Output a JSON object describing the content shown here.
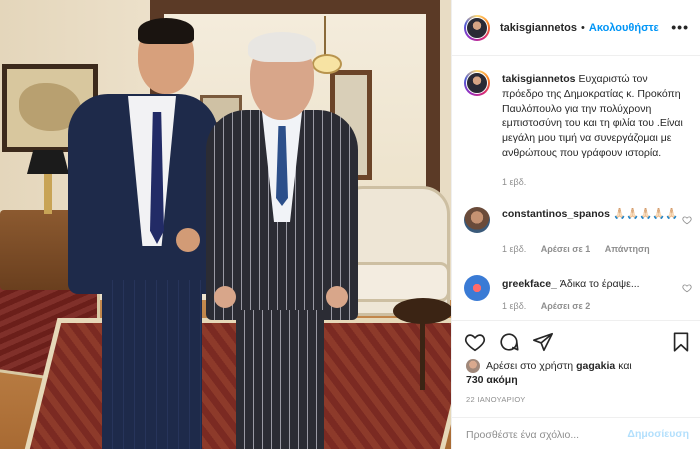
{
  "header": {
    "username": "takisgiannetos",
    "separator": "•",
    "follow_label": "Ακολουθήστε",
    "more_label": "•••"
  },
  "caption": {
    "username": "takisgiannetos",
    "text": "Ευχαριστώ τον πρόεδρο της Δημοκρατίας κ. Προκόπη Παυλόπουλο για την πολύχρονη εμπιστοσύνη του και τη φιλία του .Είναι μεγάλη μου τιμή να συνεργάζομαι με ανθρώπους που γράφουν ιστορία.",
    "age": "1 εβδ."
  },
  "comments": [
    {
      "username": "constantinos_spanos",
      "text": "🙏🏻🙏🏻🙏🏻🙏🏻🙏🏻",
      "age": "1 εβδ.",
      "likes": "Αρέσει σε 1",
      "reply": "Απάντηση"
    },
    {
      "username": "greekface_",
      "text": "Άδικα το έραψε...",
      "age": "1 εβδ.",
      "likes": "Αρέσει σε 2",
      "reply": ""
    }
  ],
  "actions": {
    "like_icon": "heart-icon",
    "comment_icon": "comment-icon",
    "share_icon": "paper-plane-icon",
    "save_icon": "bookmark-icon"
  },
  "likes": {
    "prefix": "Αρέσει στο χρήστη",
    "user": "gagakia",
    "conjunction": "και",
    "others": "730 ακόμη"
  },
  "date": "22 ΙΑΝΟΥΑΡΙΟΥ",
  "add_comment": {
    "placeholder": "Προσθέστε ένα σχόλιο...",
    "post_label": "Δημοσίευση"
  },
  "colors": {
    "link_blue": "#0095f6",
    "post_disabled": "#b2dffc",
    "muted_text": "#8e8e8e"
  }
}
